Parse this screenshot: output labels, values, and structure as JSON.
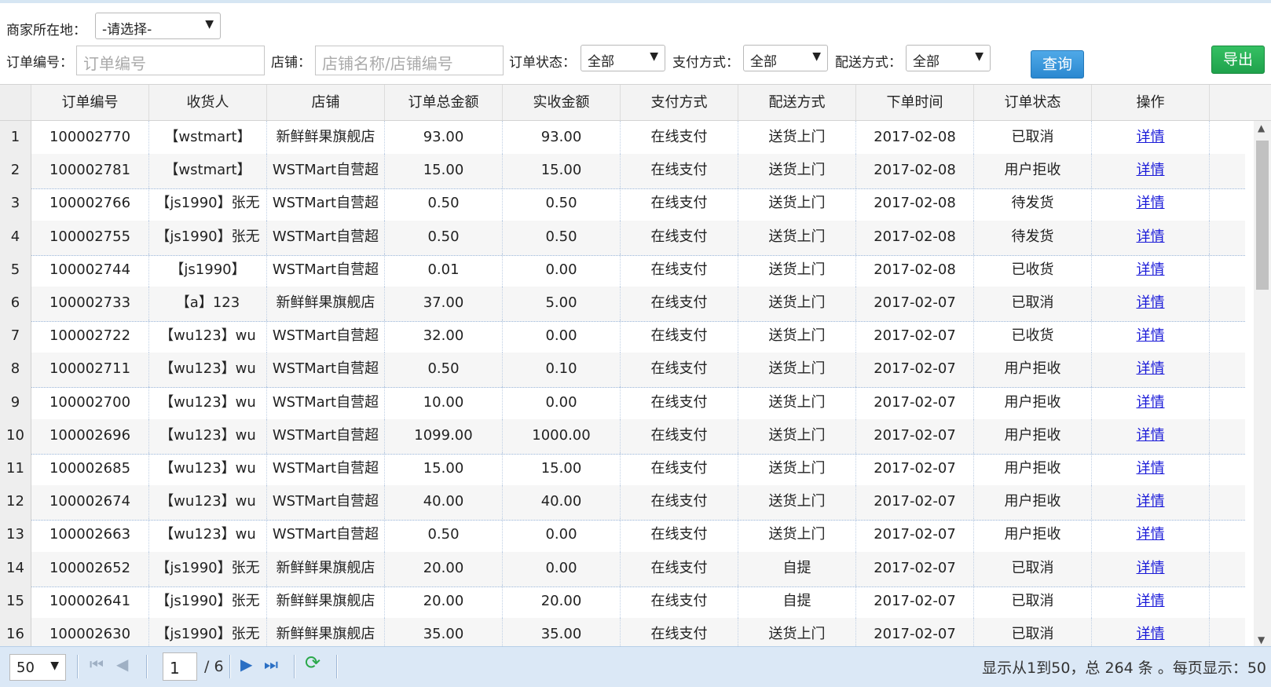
{
  "filters": {
    "location_label": "商家所在地：",
    "location_value": "-请选择-",
    "order_no_label": "订单编号：",
    "order_no_placeholder": "订单编号",
    "shop_label": "店铺：",
    "shop_placeholder": "店铺名称/店铺编号",
    "status_label": "订单状态：",
    "status_value": "全部",
    "payment_label": "支付方式：",
    "payment_value": "全部",
    "delivery_label": "配送方式：",
    "delivery_value": "全部",
    "query_label": "查询",
    "export_label": "导出"
  },
  "table": {
    "headers": [
      "订单编号",
      "收货人",
      "店铺",
      "订单总金额",
      "实收金额",
      "支付方式",
      "配送方式",
      "下单时间",
      "订单状态",
      "操作"
    ],
    "rows": [
      {
        "n": "1",
        "id": "100002770",
        "consignee": "【wstmart】",
        "shop": "新鲜鲜果旗舰店",
        "total": "93.00",
        "paid": "93.00",
        "payment": "在线支付",
        "delivery": "送货上门",
        "date": "2017-02-08",
        "status": "已取消",
        "action": "详情"
      },
      {
        "n": "2",
        "id": "100002781",
        "consignee": "【wstmart】",
        "shop": "WSTMart自营超",
        "total": "15.00",
        "paid": "15.00",
        "payment": "在线支付",
        "delivery": "送货上门",
        "date": "2017-02-08",
        "status": "用户拒收",
        "action": "详情"
      },
      {
        "n": "3",
        "id": "100002766",
        "consignee": "【js1990】张无",
        "shop": "WSTMart自营超",
        "total": "0.50",
        "paid": "0.50",
        "payment": "在线支付",
        "delivery": "送货上门",
        "date": "2017-02-08",
        "status": "待发货",
        "action": "详情"
      },
      {
        "n": "4",
        "id": "100002755",
        "consignee": "【js1990】张无",
        "shop": "WSTMart自营超",
        "total": "0.50",
        "paid": "0.50",
        "payment": "在线支付",
        "delivery": "送货上门",
        "date": "2017-02-08",
        "status": "待发货",
        "action": "详情"
      },
      {
        "n": "5",
        "id": "100002744",
        "consignee": "【js1990】",
        "shop": "WSTMart自营超",
        "total": "0.01",
        "paid": "0.00",
        "payment": "在线支付",
        "delivery": "送货上门",
        "date": "2017-02-08",
        "status": "已收货",
        "action": "详情"
      },
      {
        "n": "6",
        "id": "100002733",
        "consignee": "【a】123",
        "shop": "新鲜鲜果旗舰店",
        "total": "37.00",
        "paid": "5.00",
        "payment": "在线支付",
        "delivery": "送货上门",
        "date": "2017-02-07",
        "status": "已取消",
        "action": "详情"
      },
      {
        "n": "7",
        "id": "100002722",
        "consignee": "【wu123】wu",
        "shop": "WSTMart自营超",
        "total": "32.00",
        "paid": "0.00",
        "payment": "在线支付",
        "delivery": "送货上门",
        "date": "2017-02-07",
        "status": "已收货",
        "action": "详情"
      },
      {
        "n": "8",
        "id": "100002711",
        "consignee": "【wu123】wu",
        "shop": "WSTMart自营超",
        "total": "0.50",
        "paid": "0.10",
        "payment": "在线支付",
        "delivery": "送货上门",
        "date": "2017-02-07",
        "status": "用户拒收",
        "action": "详情"
      },
      {
        "n": "9",
        "id": "100002700",
        "consignee": "【wu123】wu",
        "shop": "WSTMart自营超",
        "total": "10.00",
        "paid": "0.00",
        "payment": "在线支付",
        "delivery": "送货上门",
        "date": "2017-02-07",
        "status": "用户拒收",
        "action": "详情"
      },
      {
        "n": "10",
        "id": "100002696",
        "consignee": "【wu123】wu",
        "shop": "WSTMart自营超",
        "total": "1099.00",
        "paid": "1000.00",
        "payment": "在线支付",
        "delivery": "送货上门",
        "date": "2017-02-07",
        "status": "用户拒收",
        "action": "详情"
      },
      {
        "n": "11",
        "id": "100002685",
        "consignee": "【wu123】wu",
        "shop": "WSTMart自营超",
        "total": "15.00",
        "paid": "15.00",
        "payment": "在线支付",
        "delivery": "送货上门",
        "date": "2017-02-07",
        "status": "用户拒收",
        "action": "详情"
      },
      {
        "n": "12",
        "id": "100002674",
        "consignee": "【wu123】wu",
        "shop": "WSTMart自营超",
        "total": "40.00",
        "paid": "40.00",
        "payment": "在线支付",
        "delivery": "送货上门",
        "date": "2017-02-07",
        "status": "用户拒收",
        "action": "详情"
      },
      {
        "n": "13",
        "id": "100002663",
        "consignee": "【wu123】wu",
        "shop": "WSTMart自营超",
        "total": "0.50",
        "paid": "0.00",
        "payment": "在线支付",
        "delivery": "送货上门",
        "date": "2017-02-07",
        "status": "用户拒收",
        "action": "详情"
      },
      {
        "n": "14",
        "id": "100002652",
        "consignee": "【js1990】张无",
        "shop": "新鲜鲜果旗舰店",
        "total": "20.00",
        "paid": "0.00",
        "payment": "在线支付",
        "delivery": "自提",
        "date": "2017-02-07",
        "status": "已取消",
        "action": "详情"
      },
      {
        "n": "15",
        "id": "100002641",
        "consignee": "【js1990】张无",
        "shop": "新鲜鲜果旗舰店",
        "total": "20.00",
        "paid": "20.00",
        "payment": "在线支付",
        "delivery": "自提",
        "date": "2017-02-07",
        "status": "已取消",
        "action": "详情"
      },
      {
        "n": "16",
        "id": "100002630",
        "consignee": "【js1990】张无",
        "shop": "新鲜鲜果旗舰店",
        "total": "35.00",
        "paid": "35.00",
        "payment": "在线支付",
        "delivery": "送货上门",
        "date": "2017-02-07",
        "status": "已取消",
        "action": "详情"
      }
    ]
  },
  "pager": {
    "page_size": "50",
    "current_page": "1",
    "total_pages": "/ 6",
    "info": "显示从1到50，总 264 条 。每页显示：50"
  }
}
